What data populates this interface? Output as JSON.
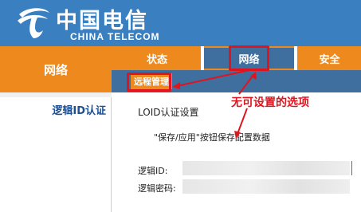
{
  "header": {
    "logo_cn": "中国电信",
    "logo_en": "CHINA TELECOM",
    "background": "#3a7fbf"
  },
  "nav": {
    "left_main": "网络",
    "left_sub": "逻辑ID认证",
    "tabs": [
      {
        "label": "状态"
      },
      {
        "label": "网络",
        "active": true
      },
      {
        "label": "安全"
      }
    ],
    "subtab": "远程管理",
    "accent_orange": "#ee8a1d",
    "active_blue": "#3f6f9e"
  },
  "content": {
    "title": "LOID认证设置",
    "hint": "\"保存/应用\"按钮保存配置数据",
    "fields": {
      "loid_label": "逻辑ID:",
      "password_label": "逻辑密码:"
    }
  },
  "annotation": {
    "text": "无可设置的选项",
    "color": "#e0141e"
  }
}
